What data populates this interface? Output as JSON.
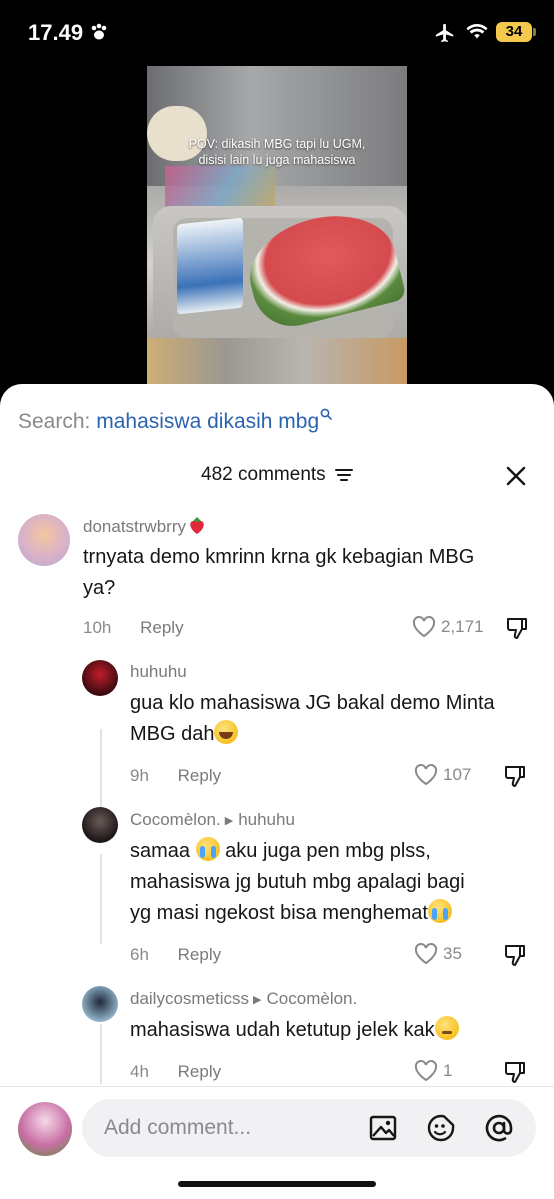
{
  "status_bar": {
    "time": "17.49",
    "battery": "34"
  },
  "video": {
    "caption_line1": "POV: dikasih MBG tapi lu UGM,",
    "caption_line2": "disisi lain lu juga mahasiswa"
  },
  "search": {
    "prefix": "Search:",
    "query": "mahasiswa dikasih mbg"
  },
  "comments_header": {
    "count_label": "482 comments"
  },
  "comments": [
    {
      "username": "donatstrwbrry",
      "text": "trnyata demo kmrinn krna gk kebagian MBG ya?",
      "time": "10h",
      "reply_label": "Reply",
      "likes": "2,171"
    },
    {
      "username": "huhuhu",
      "text": "gua klo mahasiswa JG bakal demo Minta MBG dah",
      "time": "9h",
      "reply_label": "Reply",
      "likes": "107"
    },
    {
      "username": "Cocomèlon.",
      "reply_to": "huhuhu",
      "text_line1": "samaa",
      "text_line1b": " aku juga pen mbg plss,",
      "text_line2": "mahasiswa jg butuh mbg apalagi bagi",
      "text_line3": "yg masi ngekost bisa menghemat",
      "time": "6h",
      "reply_label": "Reply",
      "likes": "35"
    },
    {
      "username": "dailycosmeticss",
      "reply_to": "Cocomèlon.",
      "text": "mahasiswa udah ketutup jelek kak",
      "time": "4h",
      "reply_label": "Reply",
      "likes": "1"
    }
  ],
  "composer": {
    "placeholder": "Add comment..."
  },
  "icons": [
    "paw-icon",
    "airplane-icon",
    "wifi-icon",
    "search-icon",
    "filter-icon",
    "close-icon",
    "heart-icon",
    "dislike-icon",
    "image-icon",
    "sticker-icon",
    "mention-icon"
  ],
  "colors": {
    "accent_link": "#2b63b0",
    "battery": "#f2c94c"
  }
}
